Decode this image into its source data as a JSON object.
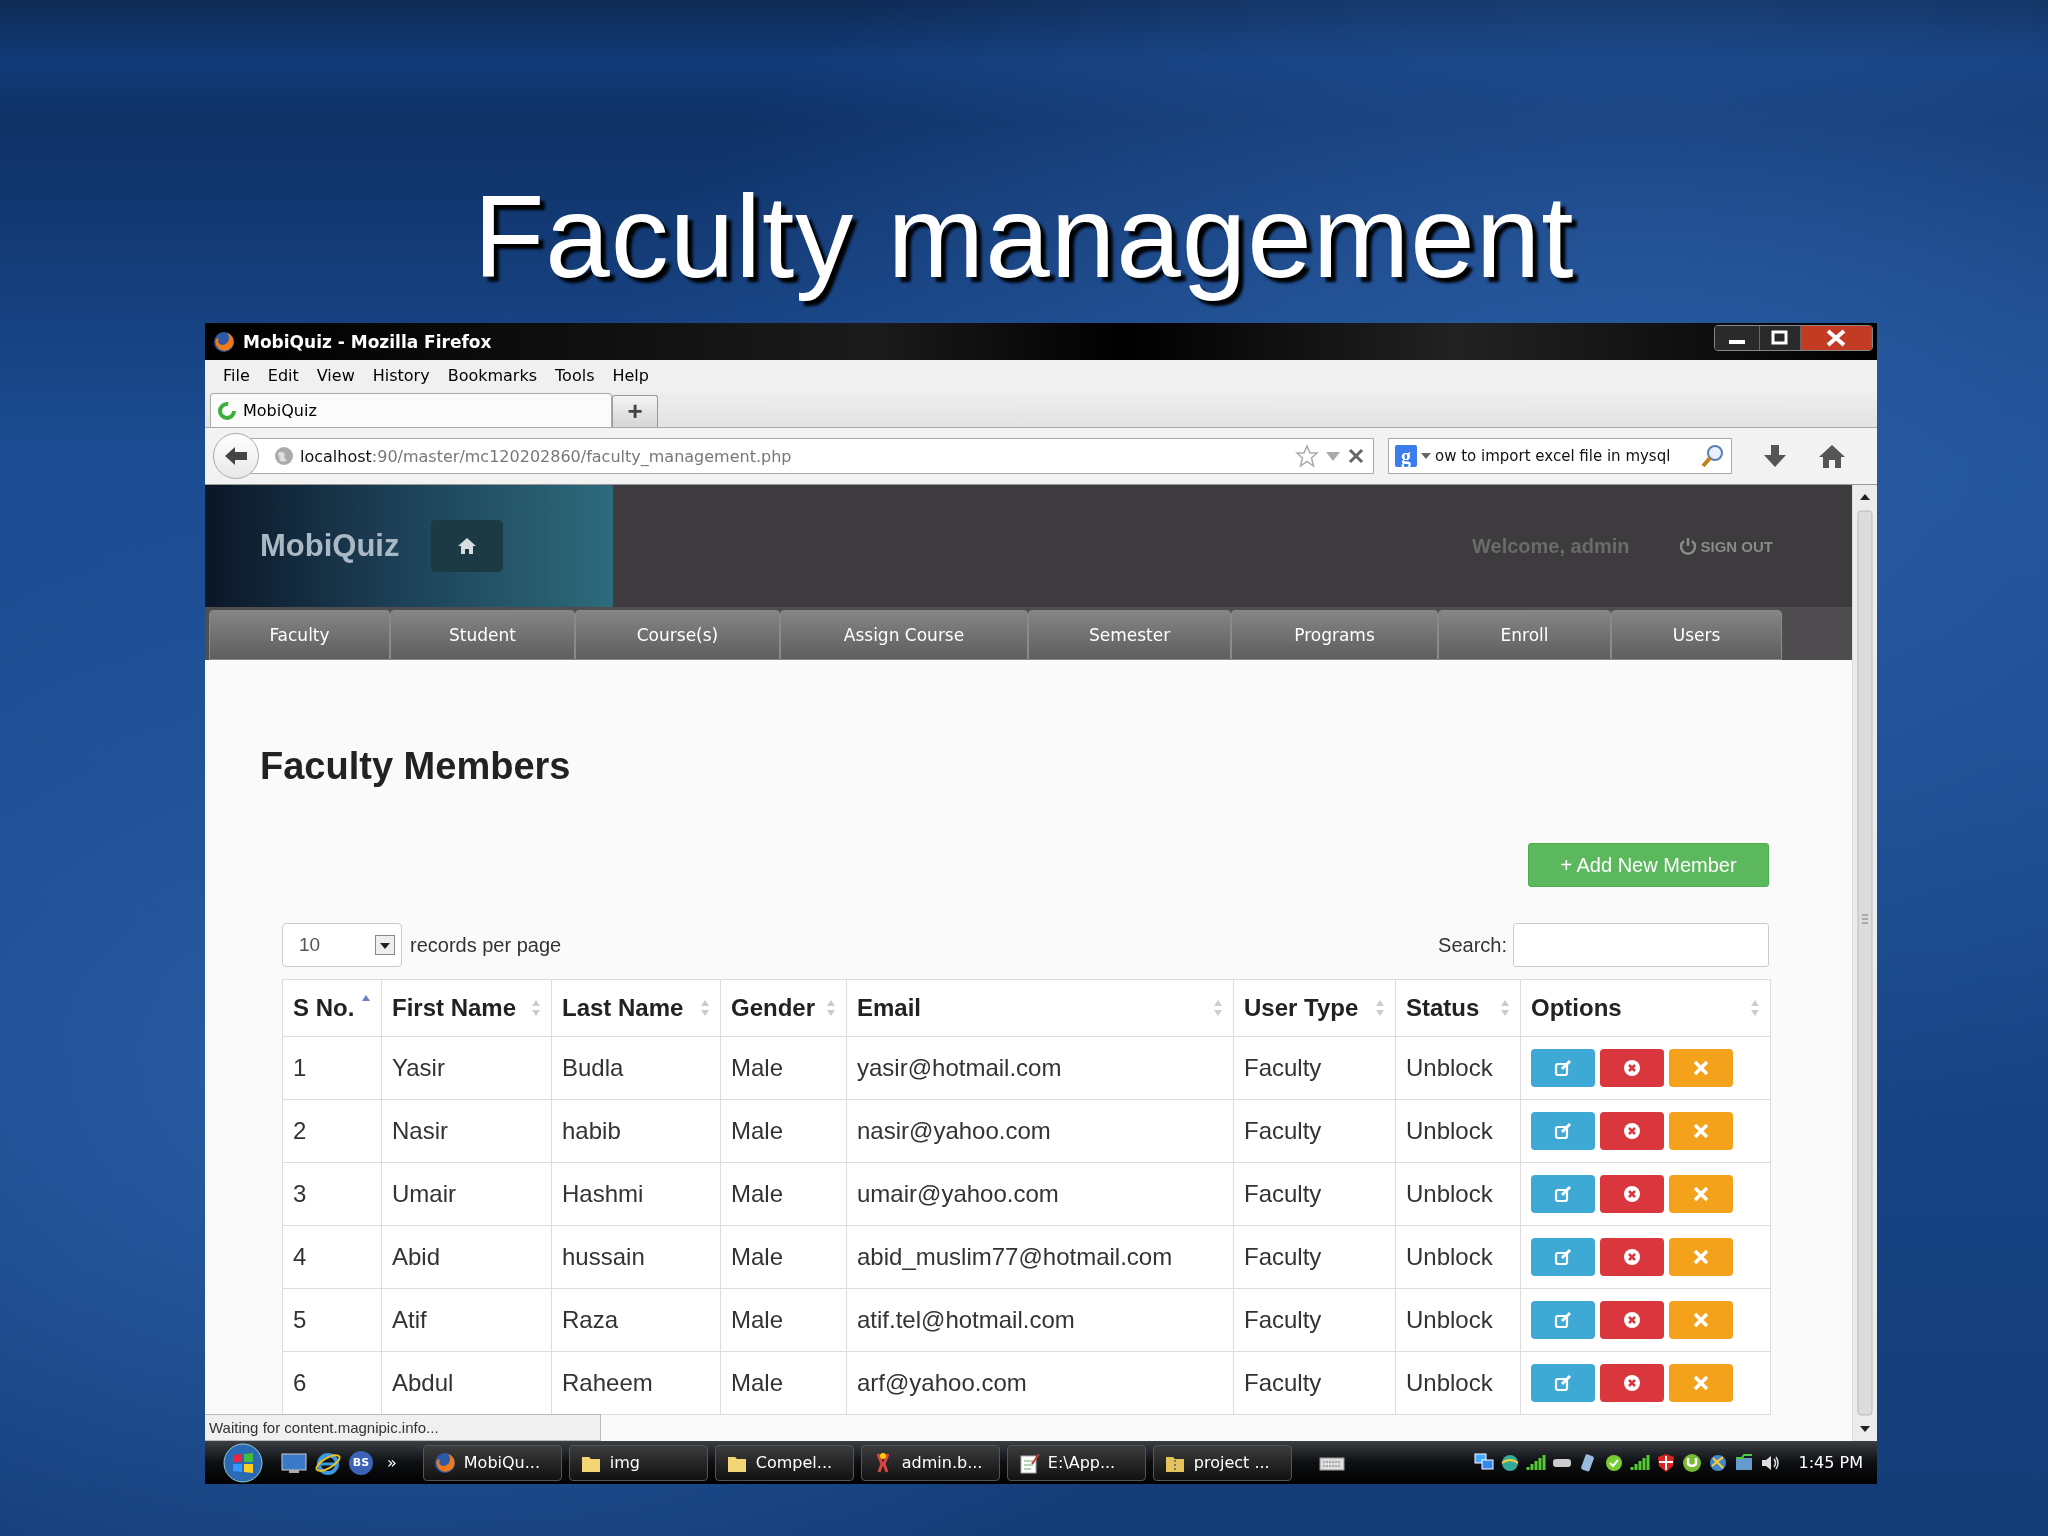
{
  "slide": {
    "title": "Faculty management"
  },
  "window": {
    "title": "MobiQuiz - Mozilla Firefox"
  },
  "menu": [
    "File",
    "Edit",
    "View",
    "History",
    "Bookmarks",
    "Tools",
    "Help"
  ],
  "tabs": [
    {
      "label": "MobiQuiz",
      "selected": true
    }
  ],
  "new_tab": "+",
  "address": {
    "host": "localhost",
    "path": ":90/master/mc120202860/faculty_management.php"
  },
  "web_search": {
    "engine_logo": "g",
    "value": "ow to import excel file in mysql"
  },
  "site": {
    "brand": "MobiQuiz",
    "welcome": "Welcome, admin",
    "sign_out": "SIGN OUT"
  },
  "nav": [
    "Faculty",
    "Student",
    "Course(s)",
    "Assign Course",
    "Semester",
    "Programs",
    "Enroll",
    "Users"
  ],
  "page": {
    "heading": "Faculty Members",
    "add_button": "+ Add New Member",
    "page_size": "10",
    "page_size_label": "records per page",
    "search_label": "Search:"
  },
  "table": {
    "columns": [
      {
        "label": "S No.",
        "sorted": true
      },
      {
        "label": "First Name",
        "sorted": false
      },
      {
        "label": "Last Name",
        "sorted": false
      },
      {
        "label": "Gender",
        "sorted": false
      },
      {
        "label": "Email",
        "sorted": false
      },
      {
        "label": "User Type",
        "sorted": false
      },
      {
        "label": "Status",
        "sorted": false
      },
      {
        "label": "Options",
        "sorted": false
      }
    ],
    "rows": [
      [
        "1",
        "Yasir",
        "Budla",
        "Male",
        "yasir@hotmail.com",
        "Faculty",
        "Unblock"
      ],
      [
        "2",
        "Nasir",
        "habib",
        "Male",
        "nasir@yahoo.com",
        "Faculty",
        "Unblock"
      ],
      [
        "3",
        "Umair",
        "Hashmi",
        "Male",
        "umair@yahoo.com",
        "Faculty",
        "Unblock"
      ],
      [
        "4",
        "Abid",
        "hussain",
        "Male",
        "abid_muslim77@hotmail.com",
        "Faculty",
        "Unblock"
      ],
      [
        "5",
        "Atif",
        "Raza",
        "Male",
        "atif.tel@hotmail.com",
        "Faculty",
        "Unblock"
      ],
      [
        "6",
        "Abdul",
        "Raheem",
        "Male",
        "arf@yahoo.com",
        "Faculty",
        "Unblock"
      ]
    ]
  },
  "status_bar": "Waiting for content.magnipic.info...",
  "taskbar": {
    "quick_launch_badge": "BS",
    "more": "»",
    "items": [
      {
        "label": "MobiQu...",
        "kind": "firefox"
      },
      {
        "label": "img",
        "kind": "folder"
      },
      {
        "label": "Compel...",
        "kind": "folder"
      },
      {
        "label": "admin.b...",
        "kind": "paint"
      },
      {
        "label": "E:\\App...",
        "kind": "notepad"
      },
      {
        "label": "project ...",
        "kind": "zip"
      }
    ],
    "clock": "1:45 PM"
  }
}
